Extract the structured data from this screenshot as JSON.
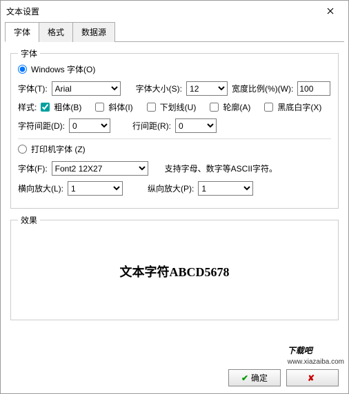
{
  "window": {
    "title": "文本设置",
    "close_tooltip": "关闭"
  },
  "tabs": {
    "font": "字体",
    "format": "格式",
    "datasource": "数据源"
  },
  "font_group": {
    "legend": "字体",
    "windows_font_radio": "Windows 字体(O)",
    "font_label": "字体(T):",
    "font_value": "Arial",
    "size_label": "字体大小(S):",
    "size_value": "12",
    "width_label": "宽度比例(%)(W):",
    "width_value": "100",
    "style_label": "样式:",
    "bold": "粗体(B)",
    "italic": "斜体(I)",
    "underline": "下划线(U)",
    "outline": "轮廓(A)",
    "invert": "黑底白字(X)",
    "charspace_label": "字符间距(D):",
    "charspace_value": "0",
    "linespace_label": "行间距(R):",
    "linespace_value": "0",
    "printer_font_radio": "打印机字体 (Z)",
    "printer_font_label": "字体(F):",
    "printer_font_value": "Font2  12X27",
    "printer_note": "支持字母、数字等ASCII字符。",
    "hscale_label": "横向放大(L):",
    "hscale_value": "1",
    "vscale_label": "纵向放大(P):",
    "vscale_value": "1"
  },
  "effect": {
    "legend": "效果",
    "preview_text": "文本字符ABCD5678"
  },
  "buttons": {
    "ok": "确定",
    "cancel": ""
  },
  "watermark": {
    "main": "下载吧",
    "sub": "www.xiazaiba.com"
  }
}
